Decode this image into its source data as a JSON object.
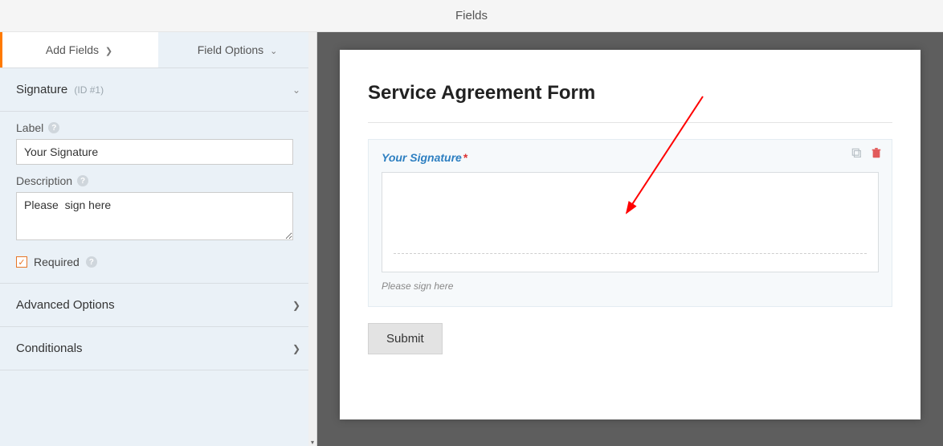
{
  "header": {
    "title": "Fields"
  },
  "sidebar": {
    "tabs": {
      "add": "Add Fields",
      "options": "Field Options"
    },
    "section": {
      "name": "Signature",
      "id_note": "(ID #1)"
    },
    "label": {
      "caption": "Label",
      "value": "Your Signature"
    },
    "description": {
      "caption": "Description",
      "value": "Please  sign here"
    },
    "required": {
      "caption": "Required",
      "checked": true
    },
    "advanced": "Advanced Options",
    "conditionals": "Conditionals"
  },
  "form": {
    "title": "Service Agreement Form",
    "field_label": "Your Signature",
    "required_mark": "*",
    "description": "Please sign here",
    "submit": "Submit"
  }
}
